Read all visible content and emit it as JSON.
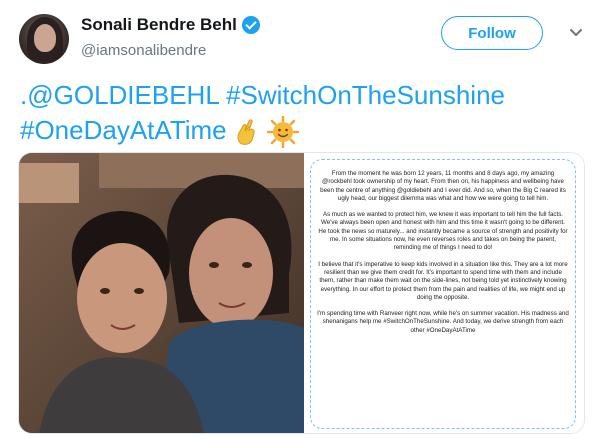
{
  "user": {
    "display_name": "Sonali Bendre Behl",
    "handle": "@iamsonalibendre",
    "verified": true,
    "avatar_icon": "profile-photo"
  },
  "actions": {
    "follow_label": "Follow",
    "menu_icon": "chevron-down-icon"
  },
  "tweet": {
    "mention": ".@GOLDIEBEHL",
    "hashtag1": "#SwitchOnTheSunshine",
    "hashtag2": "#OneDayAtATime",
    "emoji_fingers": "🤞",
    "emoji_sun": "🌞"
  },
  "note": {
    "paragraphs": [
      "From the moment he was born 12 years, 11 months and 8 days ago, my amazing @rockbehl took ownership of my heart. From then on, his happiness and wellbeing have been the centre of anything @goldiebehl and I ever did. And so, when the Big C reared its ugly head, our biggest dilemma was what and how we were going to tell him.",
      "As much as we wanted to protect him, we knew it was important to tell him the full facts. We've always been open and honest with him and this time it wasn't going to be different. He took the news so maturely... and instantly became a source of strength and positivity for me. In some situations now, he even reverses roles and takes on being the parent, reminding me of things I need to do!",
      "I believe that it's imperative to keep kids involved in a situation like this. They are a lot more resilient than we give them credit for. It's important to spend time with them and include them, rather than make them wait on the side-lines, not being told yet instinctively knowing everything. In our effort to protect them from the pain and realities of life, we might end up doing the opposite.",
      "I'm spending time with Ranveer right now, while he's on summer vacation. His madness and shenanigans help me #SwitchOnTheSunshine. And today, we derive strength from each other #OneDayAtATime"
    ]
  },
  "colors": {
    "link": "#1da1f2",
    "text": "#14171a",
    "secondary": "#657786",
    "note_border": "#7fc4e3"
  }
}
